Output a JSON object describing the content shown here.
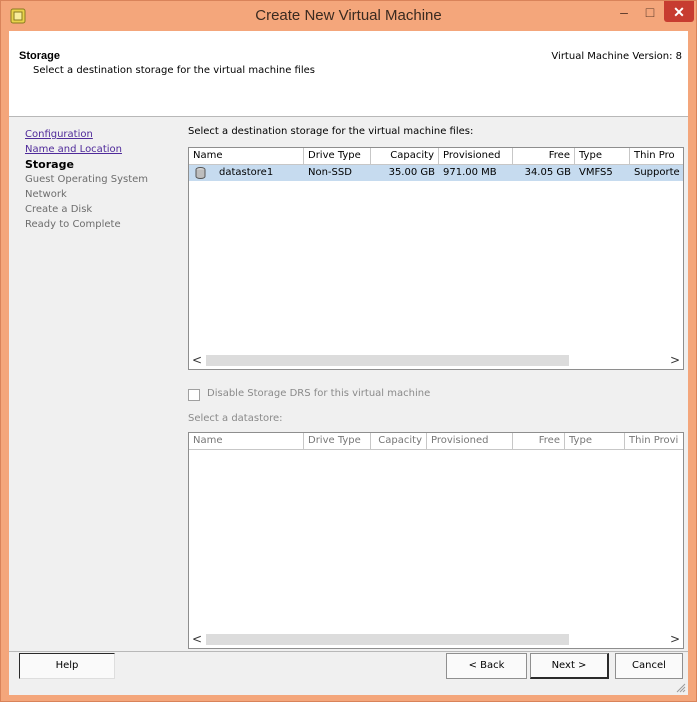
{
  "window": {
    "title": "Create New Virtual Machine",
    "min_glyph": "–",
    "max_glyph": "□",
    "close_glyph": "✕"
  },
  "header": {
    "title": "Storage",
    "subtitle": "Select a destination storage for the virtual machine files",
    "version": "Virtual Machine Version: 8"
  },
  "nav": {
    "items": [
      {
        "label": "Configuration",
        "state": "link"
      },
      {
        "label": "Name and Location",
        "state": "link"
      },
      {
        "label": "Storage",
        "state": "current"
      },
      {
        "label": "Guest Operating System",
        "state": "disabled"
      },
      {
        "label": "Network",
        "state": "disabled"
      },
      {
        "label": "Create a Disk",
        "state": "disabled"
      },
      {
        "label": "Ready to Complete",
        "state": "disabled"
      }
    ]
  },
  "storage_prompt": "Select a destination storage for the virtual machine files:",
  "datastore_table": {
    "columns": [
      "Name",
      "Drive Type",
      "Capacity",
      "Provisioned",
      "Free",
      "Type",
      "Thin Pro"
    ],
    "rows": [
      {
        "name": "datastore1",
        "drive_type": "Non-SSD",
        "capacity": "35.00 GB",
        "provisioned": "971.00 MB",
        "free": "34.05 GB",
        "type": "VMFS5",
        "thin": "Supporte"
      }
    ]
  },
  "scroll": {
    "left_arrow": "<",
    "right_arrow": ">"
  },
  "disable_drs": {
    "label": "Disable Storage DRS for this virtual machine",
    "checked": false
  },
  "select_datastore_label": "Select a datastore:",
  "datastore_table2": {
    "columns": [
      "Name",
      "Drive Type",
      "Capacity",
      "Provisioned",
      "Free",
      "Type",
      "Thin Provi"
    ]
  },
  "footer": {
    "help": "Help",
    "back": "< Back",
    "next": "Next >",
    "cancel": "Cancel"
  },
  "colors": {
    "title_bar": "#f4a67b",
    "close_button": "#c73c30",
    "selected_row": "#c6dbef",
    "link": "#4f2a9a"
  }
}
